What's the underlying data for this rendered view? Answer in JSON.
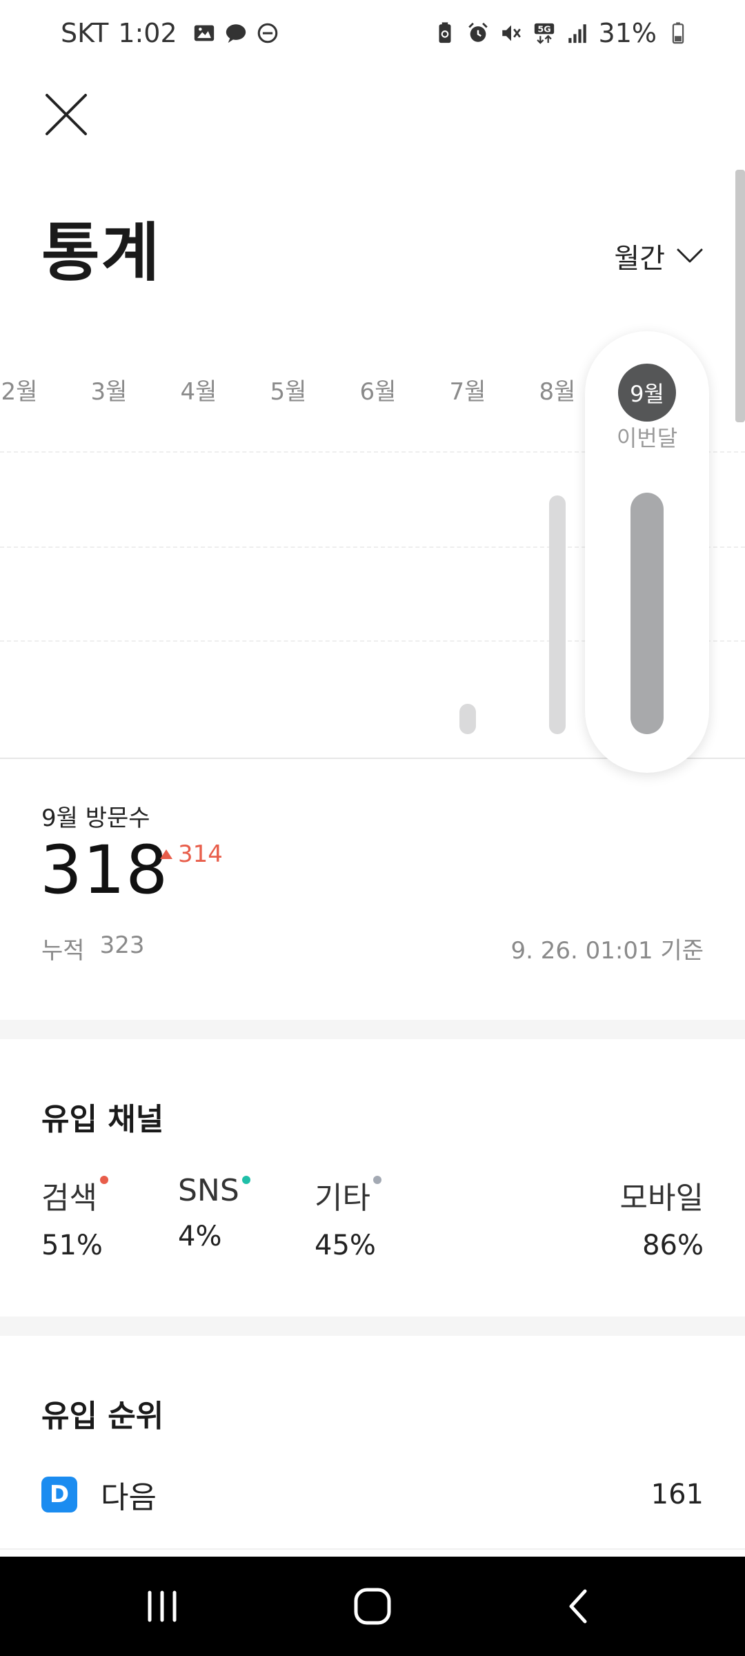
{
  "status_bar": {
    "carrier": "SKT",
    "time": "1:02",
    "battery": "31%"
  },
  "header": {
    "title": "통계",
    "period_label": "월간"
  },
  "chart_data": {
    "type": "bar",
    "categories": [
      "2월",
      "3월",
      "4월",
      "5월",
      "6월",
      "7월",
      "8월",
      "9월"
    ],
    "values": [
      0,
      0,
      0,
      0,
      0,
      9,
      314,
      318
    ],
    "current_category": "9월",
    "current_caption": "이번달",
    "ylim": [
      0,
      318
    ],
    "grid": true
  },
  "visits": {
    "label": "9월 방문수",
    "value": "318",
    "delta": "314",
    "cumulative_label": "누적",
    "cumulative_value": "323",
    "as_of": "9. 26. 01:01 기준"
  },
  "channels": {
    "title": "유입 채널",
    "items": [
      {
        "name": "검색",
        "value": "51%",
        "dot_color": "#e85d4a"
      },
      {
        "name": "SNS",
        "value": "4%",
        "dot_color": "#1fbfa8"
      },
      {
        "name": "기타",
        "value": "45%",
        "dot_color": "#a3a9b3"
      }
    ],
    "mobile": {
      "name": "모바일",
      "value": "86%"
    }
  },
  "ranking": {
    "title": "유입 순위",
    "items": [
      {
        "logo": "D",
        "name": "다음",
        "count": "161"
      }
    ]
  },
  "colors": {
    "accent_red": "#e85d4a",
    "bar_inactive": "#dadadb",
    "bar_active": "#a8a9ab"
  }
}
